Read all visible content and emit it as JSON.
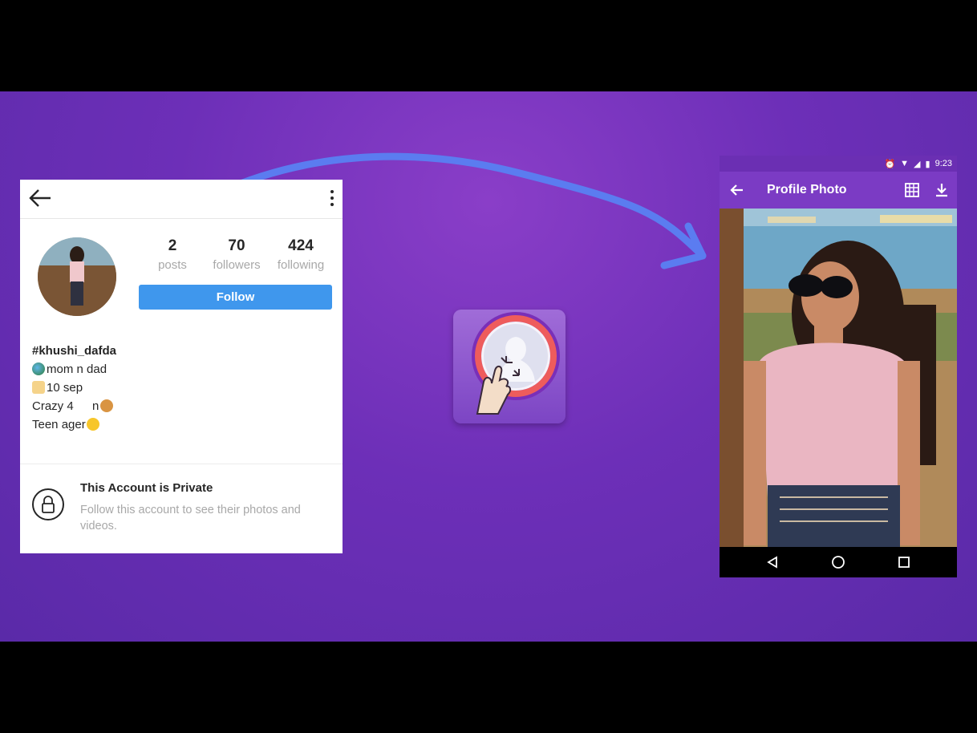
{
  "profile": {
    "username": "#khushi_dafda",
    "stats": [
      {
        "value": "2",
        "label": "posts"
      },
      {
        "value": "70",
        "label": "followers"
      },
      {
        "value": "424",
        "label": "following"
      }
    ],
    "follow_label": "Follow",
    "bio_lines": [
      {
        "text": "mom n dad",
        "icon": "globe-emoji"
      },
      {
        "text": "10 sep",
        "icon": "cake-emoji"
      },
      {
        "text": "Crazy 4   n",
        "icon": "food-emoji"
      },
      {
        "text": "Teen ager",
        "icon": "laughing-emoji"
      }
    ],
    "private_title": "This Account is Private",
    "private_desc": "Follow this account to see their photos and videos."
  },
  "phone": {
    "time": "9:23",
    "title": "Profile Photo"
  },
  "colors": {
    "background": "#6d2fb8",
    "follow_button": "#3f97ed",
    "arrow": "#5b7cf0",
    "app_bar": "#7b3bc4"
  }
}
